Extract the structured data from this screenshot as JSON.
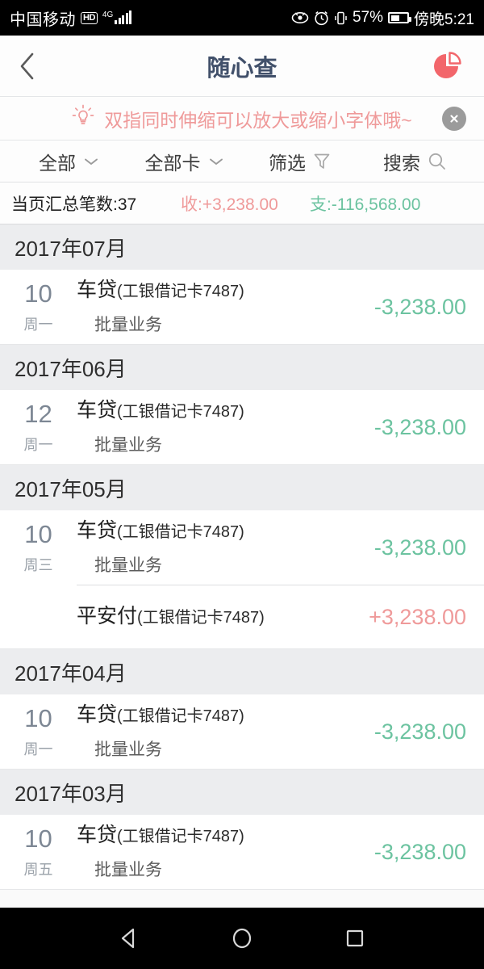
{
  "statusbar": {
    "carrier": "中国移动",
    "hd_badge": "HD",
    "network": "4G",
    "battery_percent": "57%",
    "clock": "傍晚5:21",
    "icons": [
      "eye-icon",
      "alarm-clock-icon",
      "vibrate-icon",
      "battery-icon"
    ]
  },
  "header": {
    "back_icon": "back-chevron-icon",
    "title": "随心查",
    "chart_icon": "pie-chart-icon",
    "accent_color": "#f2666b",
    "title_color": "#41506a"
  },
  "tip": {
    "icon": "lightbulb-icon",
    "text": "双指同时伸缩可以放大或缩小字体哦~",
    "close_icon": "close-icon",
    "color": "#ef9a9a"
  },
  "filterbar": {
    "items": [
      {
        "label": "全部",
        "icon": "chevron-down-icon"
      },
      {
        "label": "全部卡",
        "icon": "chevron-down-icon"
      },
      {
        "label": "筛选",
        "icon": "funnel-icon"
      },
      {
        "label": "搜索",
        "icon": "search-icon"
      }
    ]
  },
  "summary": {
    "count_label": "当页汇总笔数:37",
    "income_label": "收:+3,238.00",
    "expense_label": "支:-116,568.00",
    "income_color": "#ef9a9a",
    "expense_color": "#6cc3a0"
  },
  "groups": [
    {
      "month": "2017年07月",
      "rows": [
        {
          "day": "10",
          "weekday": "周一",
          "title": "车贷",
          "account": "(工银借记卡7487)",
          "sub": "批量业务",
          "amount": "-3,238.00",
          "sign": "neg"
        }
      ]
    },
    {
      "month": "2017年06月",
      "rows": [
        {
          "day": "12",
          "weekday": "周一",
          "title": "车贷",
          "account": "(工银借记卡7487)",
          "sub": "批量业务",
          "amount": "-3,238.00",
          "sign": "neg"
        }
      ]
    },
    {
      "month": "2017年05月",
      "rows": [
        {
          "day": "10",
          "weekday": "周三",
          "title": "车贷",
          "account": "(工银借记卡7487)",
          "sub": "批量业务",
          "amount": "-3,238.00",
          "sign": "neg"
        },
        {
          "day": "",
          "weekday": "",
          "title": "平安付",
          "account": "(工银借记卡7487)",
          "sub": "",
          "amount": "+3,238.00",
          "sign": "pos"
        }
      ]
    },
    {
      "month": "2017年04月",
      "rows": [
        {
          "day": "10",
          "weekday": "周一",
          "title": "车贷",
          "account": "(工银借记卡7487)",
          "sub": "批量业务",
          "amount": "-3,238.00",
          "sign": "neg"
        }
      ]
    },
    {
      "month": "2017年03月",
      "rows": [
        {
          "day": "10",
          "weekday": "周五",
          "title": "车贷",
          "account": "(工银借记卡7487)",
          "sub": "批量业务",
          "amount": "-3,238.00",
          "sign": "neg"
        }
      ]
    }
  ],
  "navbar": {
    "back": "nav-back-icon",
    "home": "nav-home-icon",
    "recents": "nav-recents-icon"
  }
}
